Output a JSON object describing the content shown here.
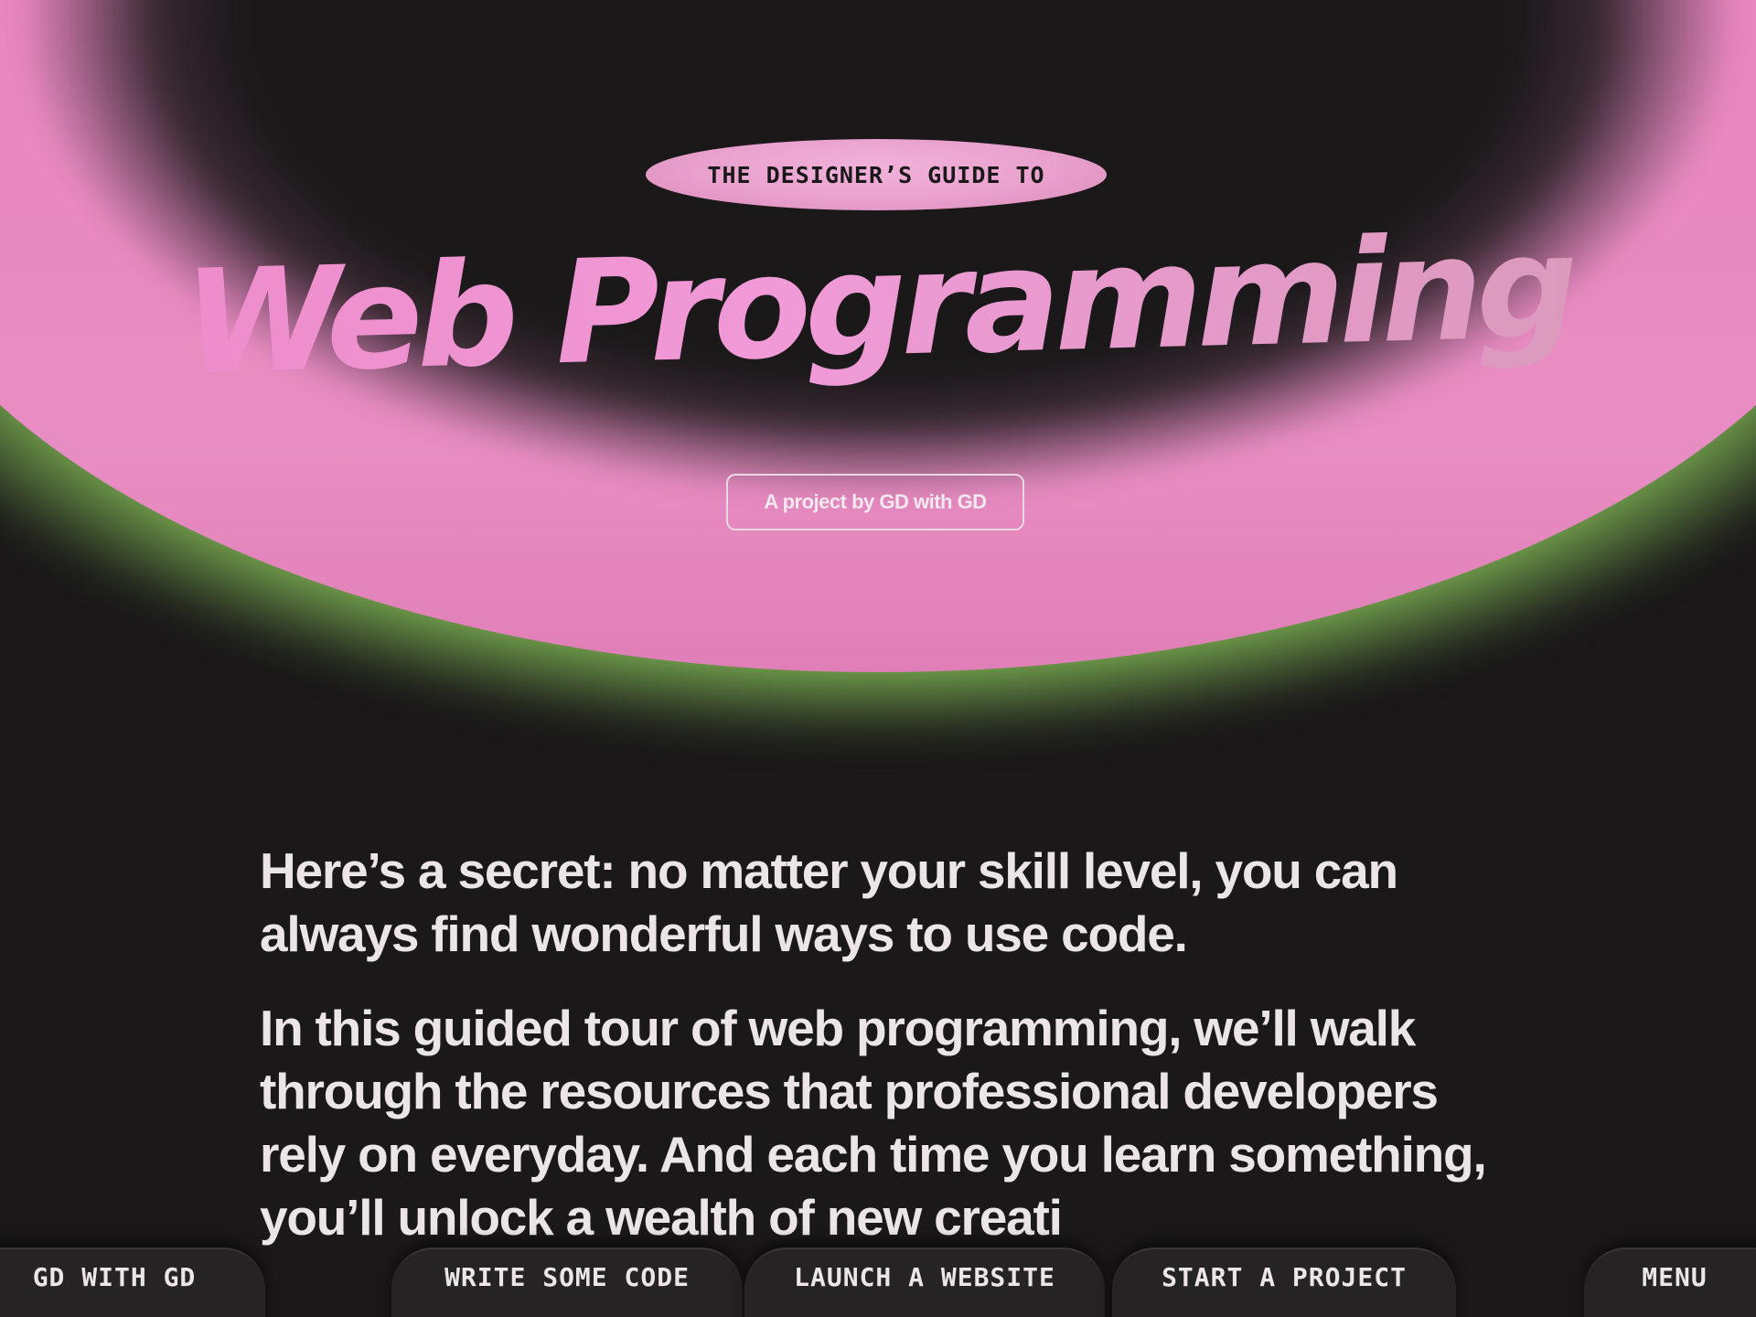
{
  "hero": {
    "eyebrow": "THE DESIGNER’S GUIDE TO",
    "title": "Web Programming",
    "credit_button": "A project by GD with GD",
    "colors": {
      "background": "#1a1819",
      "pink": "#e886c0",
      "green": "#8fce5e",
      "title_pink": "#ee8fcd"
    }
  },
  "intro": {
    "paragraph_1": "Here’s a secret: no matter your skill level, you can always find wonderful ways to use code.",
    "paragraph_2": "In this guided tour of web programming, we’ll walk through the resources that professional developers rely on everyday. And each time you learn something, you’ll unlock a wealth of new creati"
  },
  "nav": {
    "home": "GD WITH GD",
    "write_code": "WRITE SOME CODE",
    "launch_website": "LAUNCH A WEBSITE",
    "start_project": "START A PROJECT",
    "menu": "MENU"
  }
}
